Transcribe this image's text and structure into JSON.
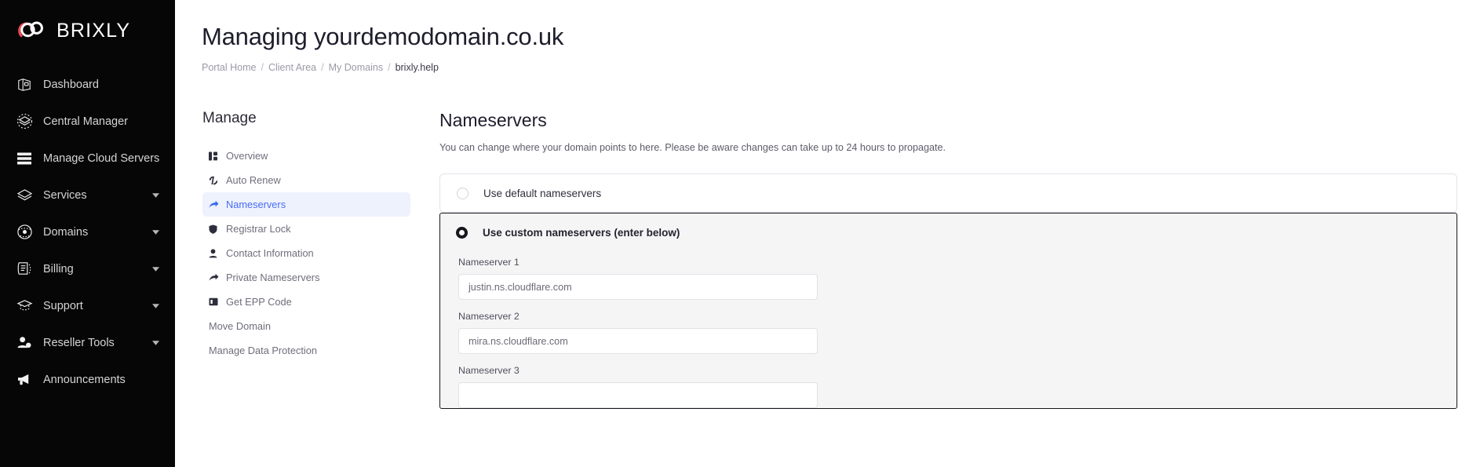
{
  "brand": {
    "name": "BRIXLY",
    "accent": "#ef4a53"
  },
  "sidebar": {
    "items": [
      {
        "label": "Dashboard",
        "icon": "dashboard-icon",
        "caret": false
      },
      {
        "label": "Central Manager",
        "icon": "central-manager-icon",
        "caret": false
      },
      {
        "label": "Manage Cloud Servers",
        "icon": "server-stack-icon",
        "caret": false
      },
      {
        "label": "Services",
        "icon": "services-box-icon",
        "caret": true
      },
      {
        "label": "Domains",
        "icon": "globe-icon",
        "caret": true
      },
      {
        "label": "Billing",
        "icon": "billing-invoice-icon",
        "caret": true
      },
      {
        "label": "Support",
        "icon": "graduation-cap-icon",
        "caret": true
      },
      {
        "label": "Reseller Tools",
        "icon": "user-tools-icon",
        "caret": true
      },
      {
        "label": "Announcements",
        "icon": "megaphone-icon",
        "caret": false
      }
    ]
  },
  "header": {
    "title": "Managing yourdemodomain.co.uk",
    "breadcrumb": [
      {
        "label": "Portal Home",
        "current": false
      },
      {
        "label": "Client Area",
        "current": false
      },
      {
        "label": "My Domains",
        "current": false
      },
      {
        "label": "brixly.help",
        "current": true
      }
    ],
    "separator": "/"
  },
  "submenu": {
    "title": "Manage",
    "items": [
      {
        "label": "Overview",
        "icon": "layout-overview-icon",
        "active": false,
        "hasIcon": true
      },
      {
        "label": "Auto Renew",
        "icon": "auto-renew-icon",
        "active": false,
        "hasIcon": true
      },
      {
        "label": "Nameservers",
        "icon": "arrow-forward-icon",
        "active": true,
        "hasIcon": true
      },
      {
        "label": "Registrar Lock",
        "icon": "shield-icon",
        "active": false,
        "hasIcon": true
      },
      {
        "label": "Contact Information",
        "icon": "person-icon",
        "active": false,
        "hasIcon": true
      },
      {
        "label": "Private Nameservers",
        "icon": "arrow-forward-icon",
        "active": false,
        "hasIcon": true
      },
      {
        "label": "Get EPP Code",
        "icon": "epp-code-icon",
        "active": false,
        "hasIcon": true
      },
      {
        "label": "Move Domain",
        "icon": "",
        "active": false,
        "hasIcon": false
      },
      {
        "label": "Manage Data Protection",
        "icon": "",
        "active": false,
        "hasIcon": false
      }
    ]
  },
  "panel": {
    "title": "Nameservers",
    "description": "You can change where your domain points to here. Please be aware changes can take up to 24 hours to propagate.",
    "options": [
      {
        "label": "Use default nameservers",
        "selected": false
      },
      {
        "label": "Use custom nameservers (enter below)",
        "selected": true
      }
    ],
    "fields": [
      {
        "label": "Nameserver 1",
        "value": "justin.ns.cloudflare.com",
        "placeholder": "Nameserver 1"
      },
      {
        "label": "Nameserver 2",
        "value": "mira.ns.cloudflare.com",
        "placeholder": "Nameserver 2"
      },
      {
        "label": "Nameserver 3",
        "value": "",
        "placeholder": "Nameserver 3"
      }
    ]
  }
}
